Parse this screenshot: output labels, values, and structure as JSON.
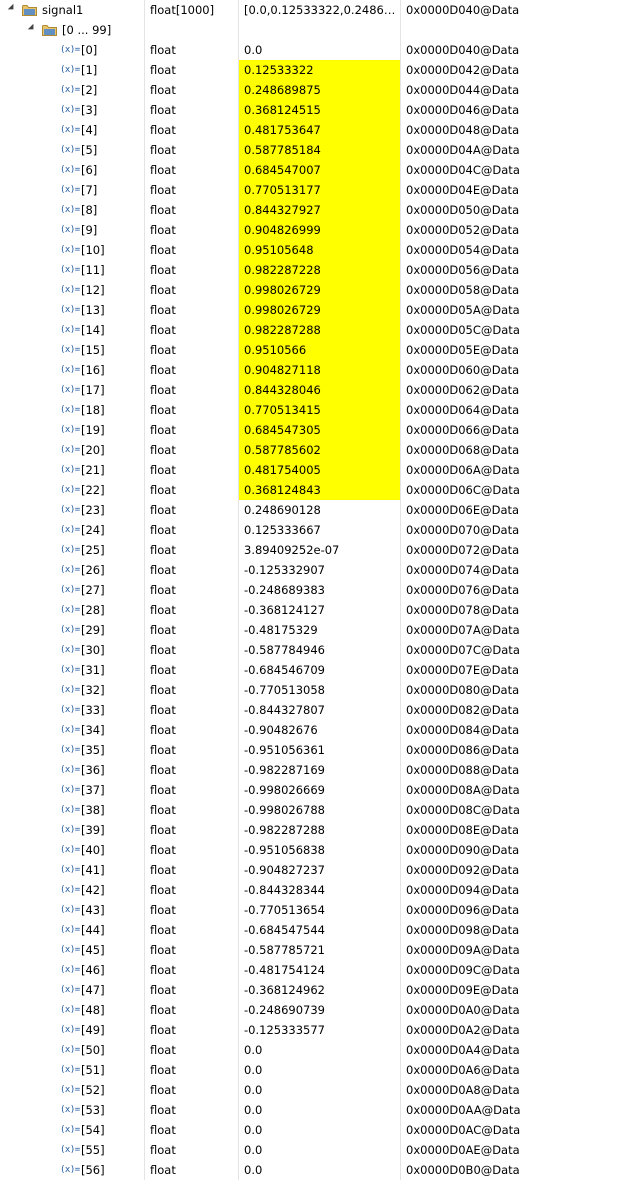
{
  "root": {
    "name": "signal1",
    "type": "float[1000]",
    "value": "[0.0,0.12533322,0.248689...",
    "location": "0x0000D040@Data"
  },
  "group": {
    "name": "[0 ... 99]"
  },
  "highlight_color": "#ffff00",
  "elements": [
    {
      "index": "[0]",
      "type": "float",
      "value": "0.0",
      "location": "0x0000D040@Data",
      "changed": false
    },
    {
      "index": "[1]",
      "type": "float",
      "value": "0.12533322",
      "location": "0x0000D042@Data",
      "changed": true
    },
    {
      "index": "[2]",
      "type": "float",
      "value": "0.248689875",
      "location": "0x0000D044@Data",
      "changed": true
    },
    {
      "index": "[3]",
      "type": "float",
      "value": "0.368124515",
      "location": "0x0000D046@Data",
      "changed": true
    },
    {
      "index": "[4]",
      "type": "float",
      "value": "0.481753647",
      "location": "0x0000D048@Data",
      "changed": true
    },
    {
      "index": "[5]",
      "type": "float",
      "value": "0.587785184",
      "location": "0x0000D04A@Data",
      "changed": true
    },
    {
      "index": "[6]",
      "type": "float",
      "value": "0.684547007",
      "location": "0x0000D04C@Data",
      "changed": true
    },
    {
      "index": "[7]",
      "type": "float",
      "value": "0.770513177",
      "location": "0x0000D04E@Data",
      "changed": true
    },
    {
      "index": "[8]",
      "type": "float",
      "value": "0.844327927",
      "location": "0x0000D050@Data",
      "changed": true
    },
    {
      "index": "[9]",
      "type": "float",
      "value": "0.904826999",
      "location": "0x0000D052@Data",
      "changed": true
    },
    {
      "index": "[10]",
      "type": "float",
      "value": "0.95105648",
      "location": "0x0000D054@Data",
      "changed": true
    },
    {
      "index": "[11]",
      "type": "float",
      "value": "0.982287228",
      "location": "0x0000D056@Data",
      "changed": true
    },
    {
      "index": "[12]",
      "type": "float",
      "value": "0.998026729",
      "location": "0x0000D058@Data",
      "changed": true
    },
    {
      "index": "[13]",
      "type": "float",
      "value": "0.998026729",
      "location": "0x0000D05A@Data",
      "changed": true
    },
    {
      "index": "[14]",
      "type": "float",
      "value": "0.982287288",
      "location": "0x0000D05C@Data",
      "changed": true
    },
    {
      "index": "[15]",
      "type": "float",
      "value": "0.9510566",
      "location": "0x0000D05E@Data",
      "changed": true
    },
    {
      "index": "[16]",
      "type": "float",
      "value": "0.904827118",
      "location": "0x0000D060@Data",
      "changed": true
    },
    {
      "index": "[17]",
      "type": "float",
      "value": "0.844328046",
      "location": "0x0000D062@Data",
      "changed": true
    },
    {
      "index": "[18]",
      "type": "float",
      "value": "0.770513415",
      "location": "0x0000D064@Data",
      "changed": true
    },
    {
      "index": "[19]",
      "type": "float",
      "value": "0.684547305",
      "location": "0x0000D066@Data",
      "changed": true
    },
    {
      "index": "[20]",
      "type": "float",
      "value": "0.587785602",
      "location": "0x0000D068@Data",
      "changed": true
    },
    {
      "index": "[21]",
      "type": "float",
      "value": "0.481754005",
      "location": "0x0000D06A@Data",
      "changed": true
    },
    {
      "index": "[22]",
      "type": "float",
      "value": "0.368124843",
      "location": "0x0000D06C@Data",
      "changed": true
    },
    {
      "index": "[23]",
      "type": "float",
      "value": "0.248690128",
      "location": "0x0000D06E@Data",
      "changed": false
    },
    {
      "index": "[24]",
      "type": "float",
      "value": "0.125333667",
      "location": "0x0000D070@Data",
      "changed": false
    },
    {
      "index": "[25]",
      "type": "float",
      "value": "3.89409252e-07",
      "location": "0x0000D072@Data",
      "changed": false
    },
    {
      "index": "[26]",
      "type": "float",
      "value": "-0.125332907",
      "location": "0x0000D074@Data",
      "changed": false
    },
    {
      "index": "[27]",
      "type": "float",
      "value": "-0.248689383",
      "location": "0x0000D076@Data",
      "changed": false
    },
    {
      "index": "[28]",
      "type": "float",
      "value": "-0.368124127",
      "location": "0x0000D078@Data",
      "changed": false
    },
    {
      "index": "[29]",
      "type": "float",
      "value": "-0.48175329",
      "location": "0x0000D07A@Data",
      "changed": false
    },
    {
      "index": "[30]",
      "type": "float",
      "value": "-0.587784946",
      "location": "0x0000D07C@Data",
      "changed": false
    },
    {
      "index": "[31]",
      "type": "float",
      "value": "-0.684546709",
      "location": "0x0000D07E@Data",
      "changed": false
    },
    {
      "index": "[32]",
      "type": "float",
      "value": "-0.770513058",
      "location": "0x0000D080@Data",
      "changed": false
    },
    {
      "index": "[33]",
      "type": "float",
      "value": "-0.844327807",
      "location": "0x0000D082@Data",
      "changed": false
    },
    {
      "index": "[34]",
      "type": "float",
      "value": "-0.90482676",
      "location": "0x0000D084@Data",
      "changed": false
    },
    {
      "index": "[35]",
      "type": "float",
      "value": "-0.951056361",
      "location": "0x0000D086@Data",
      "changed": false
    },
    {
      "index": "[36]",
      "type": "float",
      "value": "-0.982287169",
      "location": "0x0000D088@Data",
      "changed": false
    },
    {
      "index": "[37]",
      "type": "float",
      "value": "-0.998026669",
      "location": "0x0000D08A@Data",
      "changed": false
    },
    {
      "index": "[38]",
      "type": "float",
      "value": "-0.998026788",
      "location": "0x0000D08C@Data",
      "changed": false
    },
    {
      "index": "[39]",
      "type": "float",
      "value": "-0.982287288",
      "location": "0x0000D08E@Data",
      "changed": false
    },
    {
      "index": "[40]",
      "type": "float",
      "value": "-0.951056838",
      "location": "0x0000D090@Data",
      "changed": false
    },
    {
      "index": "[41]",
      "type": "float",
      "value": "-0.904827237",
      "location": "0x0000D092@Data",
      "changed": false
    },
    {
      "index": "[42]",
      "type": "float",
      "value": "-0.844328344",
      "location": "0x0000D094@Data",
      "changed": false
    },
    {
      "index": "[43]",
      "type": "float",
      "value": "-0.770513654",
      "location": "0x0000D096@Data",
      "changed": false
    },
    {
      "index": "[44]",
      "type": "float",
      "value": "-0.684547544",
      "location": "0x0000D098@Data",
      "changed": false
    },
    {
      "index": "[45]",
      "type": "float",
      "value": "-0.587785721",
      "location": "0x0000D09A@Data",
      "changed": false
    },
    {
      "index": "[46]",
      "type": "float",
      "value": "-0.481754124",
      "location": "0x0000D09C@Data",
      "changed": false
    },
    {
      "index": "[47]",
      "type": "float",
      "value": "-0.368124962",
      "location": "0x0000D09E@Data",
      "changed": false
    },
    {
      "index": "[48]",
      "type": "float",
      "value": "-0.248690739",
      "location": "0x0000D0A0@Data",
      "changed": false
    },
    {
      "index": "[49]",
      "type": "float",
      "value": "-0.125333577",
      "location": "0x0000D0A2@Data",
      "changed": false
    },
    {
      "index": "[50]",
      "type": "float",
      "value": "0.0",
      "location": "0x0000D0A4@Data",
      "changed": false
    },
    {
      "index": "[51]",
      "type": "float",
      "value": "0.0",
      "location": "0x0000D0A6@Data",
      "changed": false
    },
    {
      "index": "[52]",
      "type": "float",
      "value": "0.0",
      "location": "0x0000D0A8@Data",
      "changed": false
    },
    {
      "index": "[53]",
      "type": "float",
      "value": "0.0",
      "location": "0x0000D0AA@Data",
      "changed": false
    },
    {
      "index": "[54]",
      "type": "float",
      "value": "0.0",
      "location": "0x0000D0AC@Data",
      "changed": false
    },
    {
      "index": "[55]",
      "type": "float",
      "value": "0.0",
      "location": "0x0000D0AE@Data",
      "changed": false
    },
    {
      "index": "[56]",
      "type": "float",
      "value": "0.0",
      "location": "0x0000D0B0@Data",
      "changed": false
    }
  ],
  "icons": {
    "expander": "expanded-triangle-icon",
    "folder": "folder-icon",
    "variable": "variable-icon",
    "variable_glyph": "(x)="
  }
}
